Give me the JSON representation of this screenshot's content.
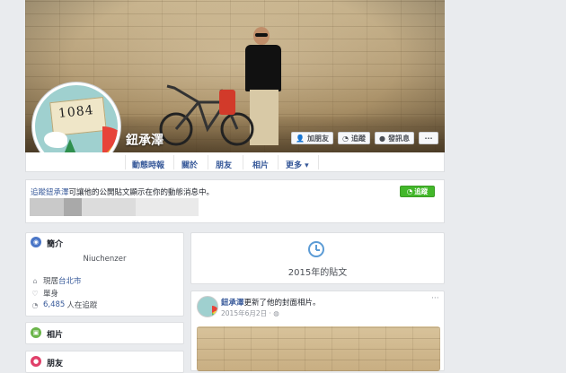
{
  "profile": {
    "name": "鈕承澤",
    "buttons": {
      "add_friend": "加朋友",
      "follow": "追蹤",
      "message": "發訊息",
      "more": "···"
    }
  },
  "tabs": [
    "動態時報",
    "關於",
    "朋友",
    "相片",
    "更多 ▾"
  ],
  "follow_notice": {
    "link": "追蹤鈕承澤",
    "text": "可讓他的公開貼文顯示在你的動態消息中。",
    "button": "追蹤"
  },
  "intro": {
    "title": "簡介",
    "username": "Niuchenzer",
    "lives_label": "現居",
    "lives_city": "台北市",
    "relationship": "單身",
    "followers_count": "6,485",
    "followers_suffix": "人在追蹤"
  },
  "photos_card": {
    "title": "相片"
  },
  "friends_card": {
    "title": "朋友"
  },
  "year_card": {
    "label": "2015年的貼文"
  },
  "post": {
    "author": "鈕承澤",
    "action": "更新了他的封面相片。",
    "date": "2015年6月2日 ·",
    "more": "···"
  },
  "colors": {
    "link": "#365899",
    "follow_green": "#42b72a",
    "background": "#e9ebee"
  }
}
